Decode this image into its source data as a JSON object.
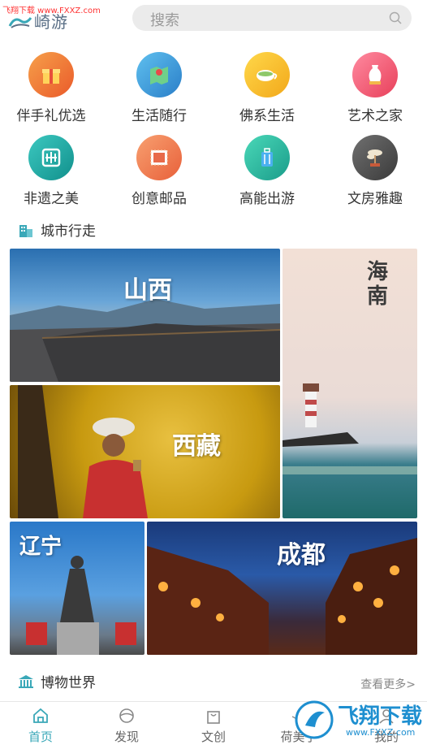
{
  "watermark": "飞翔下载 www.FXXZ.com",
  "header": {
    "logo_text": "崎游"
  },
  "search": {
    "placeholder": "搜索"
  },
  "categories": [
    {
      "label": "伴手礼优选",
      "icon": "gift-icon",
      "color": "#ef7a35"
    },
    {
      "label": "生活随行",
      "icon": "map-pin-icon",
      "color": "#3a9bd8"
    },
    {
      "label": "佛系生活",
      "icon": "tea-cup-icon",
      "color": "#f4c21c"
    },
    {
      "label": "艺术之家",
      "icon": "vase-icon",
      "color": "#ef5a74"
    },
    {
      "label": "非遗之美",
      "icon": "heritage-icon",
      "color": "#1aa8a4"
    },
    {
      "label": "创意邮品",
      "icon": "stamp-icon",
      "color": "#f07a4a"
    },
    {
      "label": "高能出游",
      "icon": "luggage-icon",
      "color": "#2ab8a4"
    },
    {
      "label": "文房雅趣",
      "icon": "bonsai-icon",
      "color": "#555555"
    }
  ],
  "city_section": {
    "title": "城市行走"
  },
  "cities": [
    {
      "name": "山西"
    },
    {
      "name": "海南"
    },
    {
      "name": "西藏"
    },
    {
      "name": "辽宁"
    },
    {
      "name": "成都"
    }
  ],
  "museum_section": {
    "title": "博物世界",
    "more": "查看更多>"
  },
  "tabs": [
    {
      "label": "首页",
      "icon": "home-icon",
      "active": true
    },
    {
      "label": "发现",
      "icon": "discover-icon",
      "active": false
    },
    {
      "label": "文创",
      "icon": "bag-icon",
      "active": false
    },
    {
      "label": "荷美子",
      "icon": "lotus-icon",
      "active": false
    },
    {
      "label": "我的",
      "icon": "user-icon",
      "active": false
    }
  ],
  "brand_badge": {
    "name": "飞翔下载",
    "url": "www.FXXZ.com"
  },
  "colors": {
    "accent": "#3aa8b8",
    "text": "#333333",
    "muted": "#888888"
  }
}
